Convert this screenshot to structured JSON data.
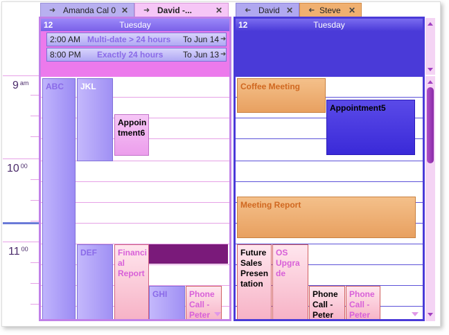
{
  "tabs_left": [
    {
      "label": "Amanda Cal 0",
      "icon": "arrow-right-icon"
    },
    {
      "label": "David -...",
      "icon": "arrow-right-icon"
    }
  ],
  "tabs_right": [
    {
      "label": "David",
      "icon": "arrow-left-icon"
    },
    {
      "label": "Steve",
      "icon": "arrow-left-icon"
    }
  ],
  "left_cal": {
    "date_num": "12",
    "day_name": "Tuesday",
    "allday": [
      {
        "time": "2:00 AM",
        "title": "Multi-date > 24 hours",
        "to": "To Jun 14"
      },
      {
        "time": "8:00 PM",
        "title": "Exactly 24 hours",
        "to": "To Jun 13"
      }
    ]
  },
  "right_cal": {
    "date_num": "12",
    "day_name": "Tuesday"
  },
  "times": [
    {
      "hour": "9",
      "suffix": "am"
    },
    {
      "hour": "10",
      "suffix": "00"
    },
    {
      "hour": "11",
      "suffix": "00"
    }
  ],
  "left_appts": {
    "abc": "ABC",
    "jkl": "JKL",
    "appointment6": "Appoin tment6",
    "def": "DEF",
    "financial": "Financi al Report",
    "ghi": "GHI",
    "phone": "Phone Call - Peter"
  },
  "right_appts": {
    "coffee": "Coffee Meeting",
    "appointment5": "Appointment5",
    "meeting_report": "Meeting Report",
    "future": "Future Sales Presen tation",
    "os": "OS Upgra de",
    "phone1": "Phone Call - Peter",
    "phone2": "Phone Call - Peter"
  },
  "colors": {
    "purple_accent": "#8a48e8",
    "blue_accent": "#4a3ad8",
    "magenta_bar": "#7a1a7a"
  }
}
